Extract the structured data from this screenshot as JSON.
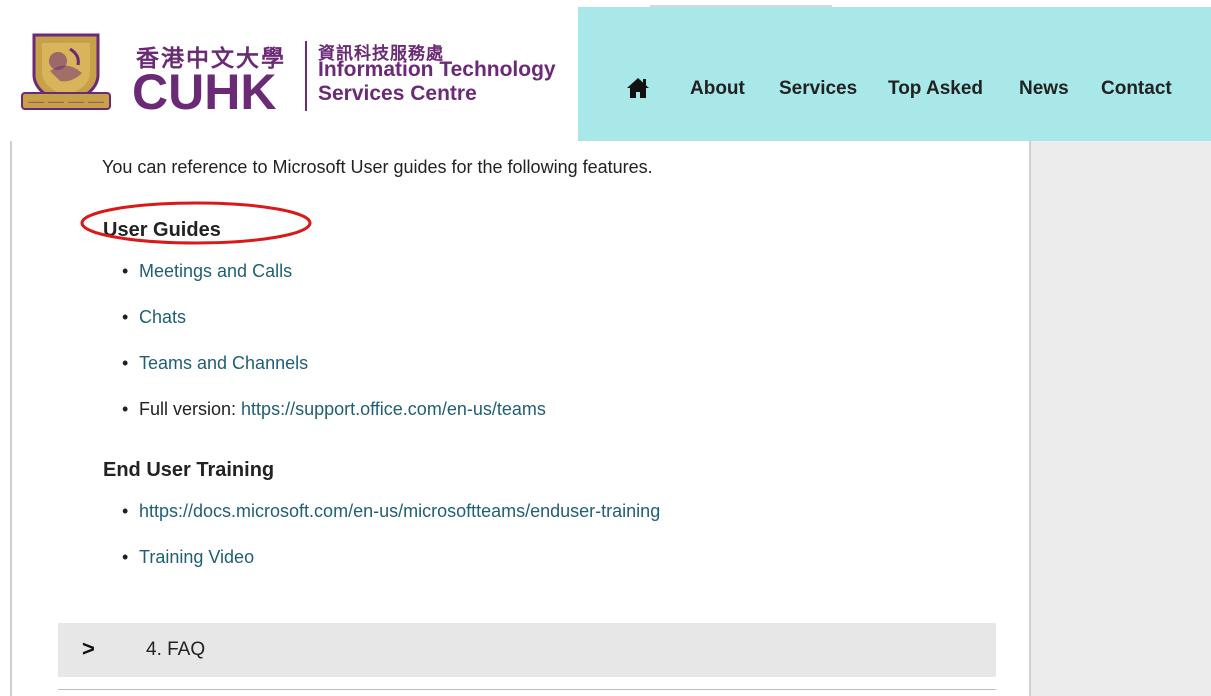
{
  "header": {
    "university_chinese": "香港中文大學",
    "university_short": "CUHK",
    "department_chinese": "資訊科技服務處",
    "department_line1": "Information Technology",
    "department_line2": "Services Centre",
    "nav": {
      "home_icon": "home-icon",
      "items": [
        {
          "label": "About"
        },
        {
          "label": "Services"
        },
        {
          "label": "Top Asked"
        },
        {
          "label": "News"
        },
        {
          "label": "Contact"
        }
      ]
    },
    "colors": {
      "brand_purple": "#6b2a76",
      "nav_background": "#a9e8e8"
    }
  },
  "main": {
    "intro": "You can reference to Microsoft User guides for the following features.",
    "user_guides": {
      "heading": "User Guides",
      "items": [
        {
          "text": "Meetings and Calls"
        },
        {
          "text": "Chats"
        },
        {
          "text": "Teams and Channels"
        },
        {
          "prefix": "Full version: ",
          "text": "https://support.office.com/en-us/teams"
        }
      ]
    },
    "end_user_training": {
      "heading": "End User Training",
      "items": [
        {
          "text": "https://docs.microsoft.com/en-us/microsoftteams/enduser-training"
        },
        {
          "text": "Training Video"
        }
      ]
    },
    "faq": {
      "chevron": ">",
      "label": "4. FAQ"
    },
    "colors": {
      "link": "#1f5f73",
      "annotation": "#d91a1a",
      "faq_background": "#e7e7e7"
    }
  }
}
